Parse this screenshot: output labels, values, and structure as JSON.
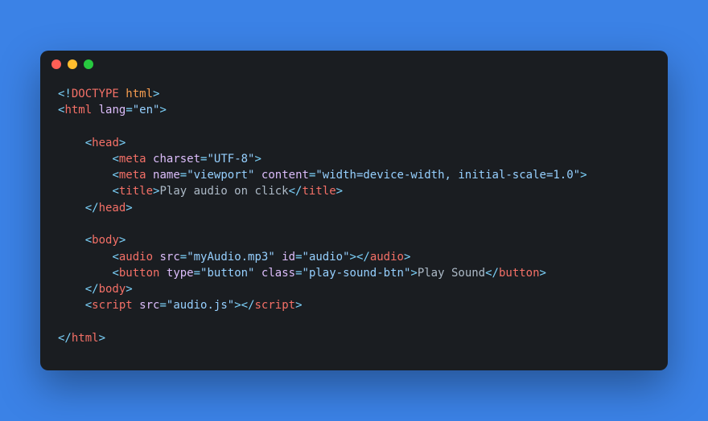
{
  "window": {
    "traffic_lights": [
      "close",
      "minimize",
      "zoom"
    ]
  },
  "code": {
    "doctype_open": "<!",
    "doctype_word": "DOCTYPE",
    "doctype_html": " html",
    "doctype_close": ">",
    "html_open_lt": "<",
    "html_tag": "html",
    "space": " ",
    "lang_attr": "lang",
    "eq": "=",
    "lang_val": "\"en\"",
    "gt": ">",
    "head_open_lt": "<",
    "head_tag": "head",
    "meta_tag": "meta",
    "charset_attr": "charset",
    "charset_val": "\"UTF-8\"",
    "close_gt": ">",
    "name_attr": "name",
    "viewport_val": "\"viewport\"",
    "content_attr": "content",
    "content_val": "\"width=device-width, initial-scale=1.0\"",
    "title_tag": "title",
    "title_text": "Play audio on click",
    "close_slash_lt": "</",
    "body_tag": "body",
    "audio_tag": "audio",
    "src_attr": "src",
    "audio_src_val": "\"myAudio.mp3\"",
    "id_attr": "id",
    "audio_id_val": "\"audio\"",
    "button_tag": "button",
    "type_attr": "type",
    "button_type_val": "\"button\"",
    "class_attr": "class",
    "button_class_val": "\"play-sound-btn\"",
    "button_text": "Play Sound",
    "script_tag": "script",
    "script_src_val": "\"audio.js\"",
    "indent1": "    ",
    "indent2": "        "
  }
}
